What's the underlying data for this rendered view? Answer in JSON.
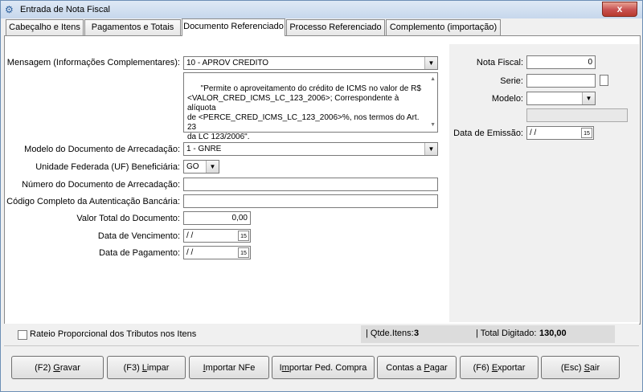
{
  "window": {
    "title": "Entrada de Nota Fiscal",
    "close": "x"
  },
  "tabs": [
    {
      "label": "Cabeçalho e Itens"
    },
    {
      "label": "Pagamentos e Totais"
    },
    {
      "label": "Documento Referenciado"
    },
    {
      "label": "Processo Referenciado"
    },
    {
      "label": "Complemento (importação)"
    }
  ],
  "form": {
    "mensagem_label": "Mensagem (Informações Complementares):",
    "mensagem_value": "10 - APROV CREDITO",
    "mensagem_text": "\"Permite o aproveitamento do crédito de ICMS no valor de R$\n<VALOR_CRED_ICMS_LC_123_2006>; Correspondente à alíquota\nde <PERCE_CRED_ICMS_LC_123_2006>%, nos termos do Art. 23\nda LC 123/2006\".",
    "modelo_label": "Modelo do Documento de Arrecadação:",
    "modelo_value": "1 - GNRE",
    "uf_label": "Unidade Federada (UF) Beneficiária:",
    "uf_value": "GO",
    "numero_label": "Número do Documento de Arrecadação:",
    "numero_value": "",
    "codigo_label": "Código Completo da Autenticação Bancária:",
    "codigo_value": "",
    "valor_label": "Valor Total do Documento:",
    "valor_value": "0,00",
    "venc_label": "Data de Vencimento:",
    "venc_value": " /  /",
    "pag_label": "Data de Pagamento:",
    "pag_value": " /  /",
    "cal_text": "15"
  },
  "right": {
    "nf_label": "Nota Fiscal:",
    "nf_value": "0",
    "serie_label": "Serie:",
    "serie_value": "",
    "modelo_label": "Modelo:",
    "modelo_value": "",
    "emissao_label": "Data de Emissão:",
    "emissao_value": " /  /"
  },
  "status": {
    "rateio_label": "Rateio Proporcional dos Tributos nos Itens",
    "qtde_label": "| Qtde.Itens:",
    "qtde_value": "3",
    "total_label": "| Total Digitado:",
    "total_value": "130,00"
  },
  "buttons": {
    "gravar": {
      "prefix": "(F2) ",
      "key": "G",
      "rest": "ravar"
    },
    "limpar": {
      "prefix": "(F3) ",
      "key": "L",
      "rest": "impar"
    },
    "importar_nfe": {
      "prefix": "",
      "key": "I",
      "rest": "mportar NFe"
    },
    "importar_ped": {
      "prefix": "I",
      "key": "m",
      "rest": "portar Ped. Compra"
    },
    "contas": {
      "prefix": "Contas a ",
      "key": "P",
      "rest": "agar"
    },
    "exportar": {
      "prefix": "(F6) ",
      "key": "E",
      "rest": "xportar"
    },
    "sair": {
      "prefix": "(Esc) ",
      "key": "S",
      "rest": "air"
    }
  }
}
